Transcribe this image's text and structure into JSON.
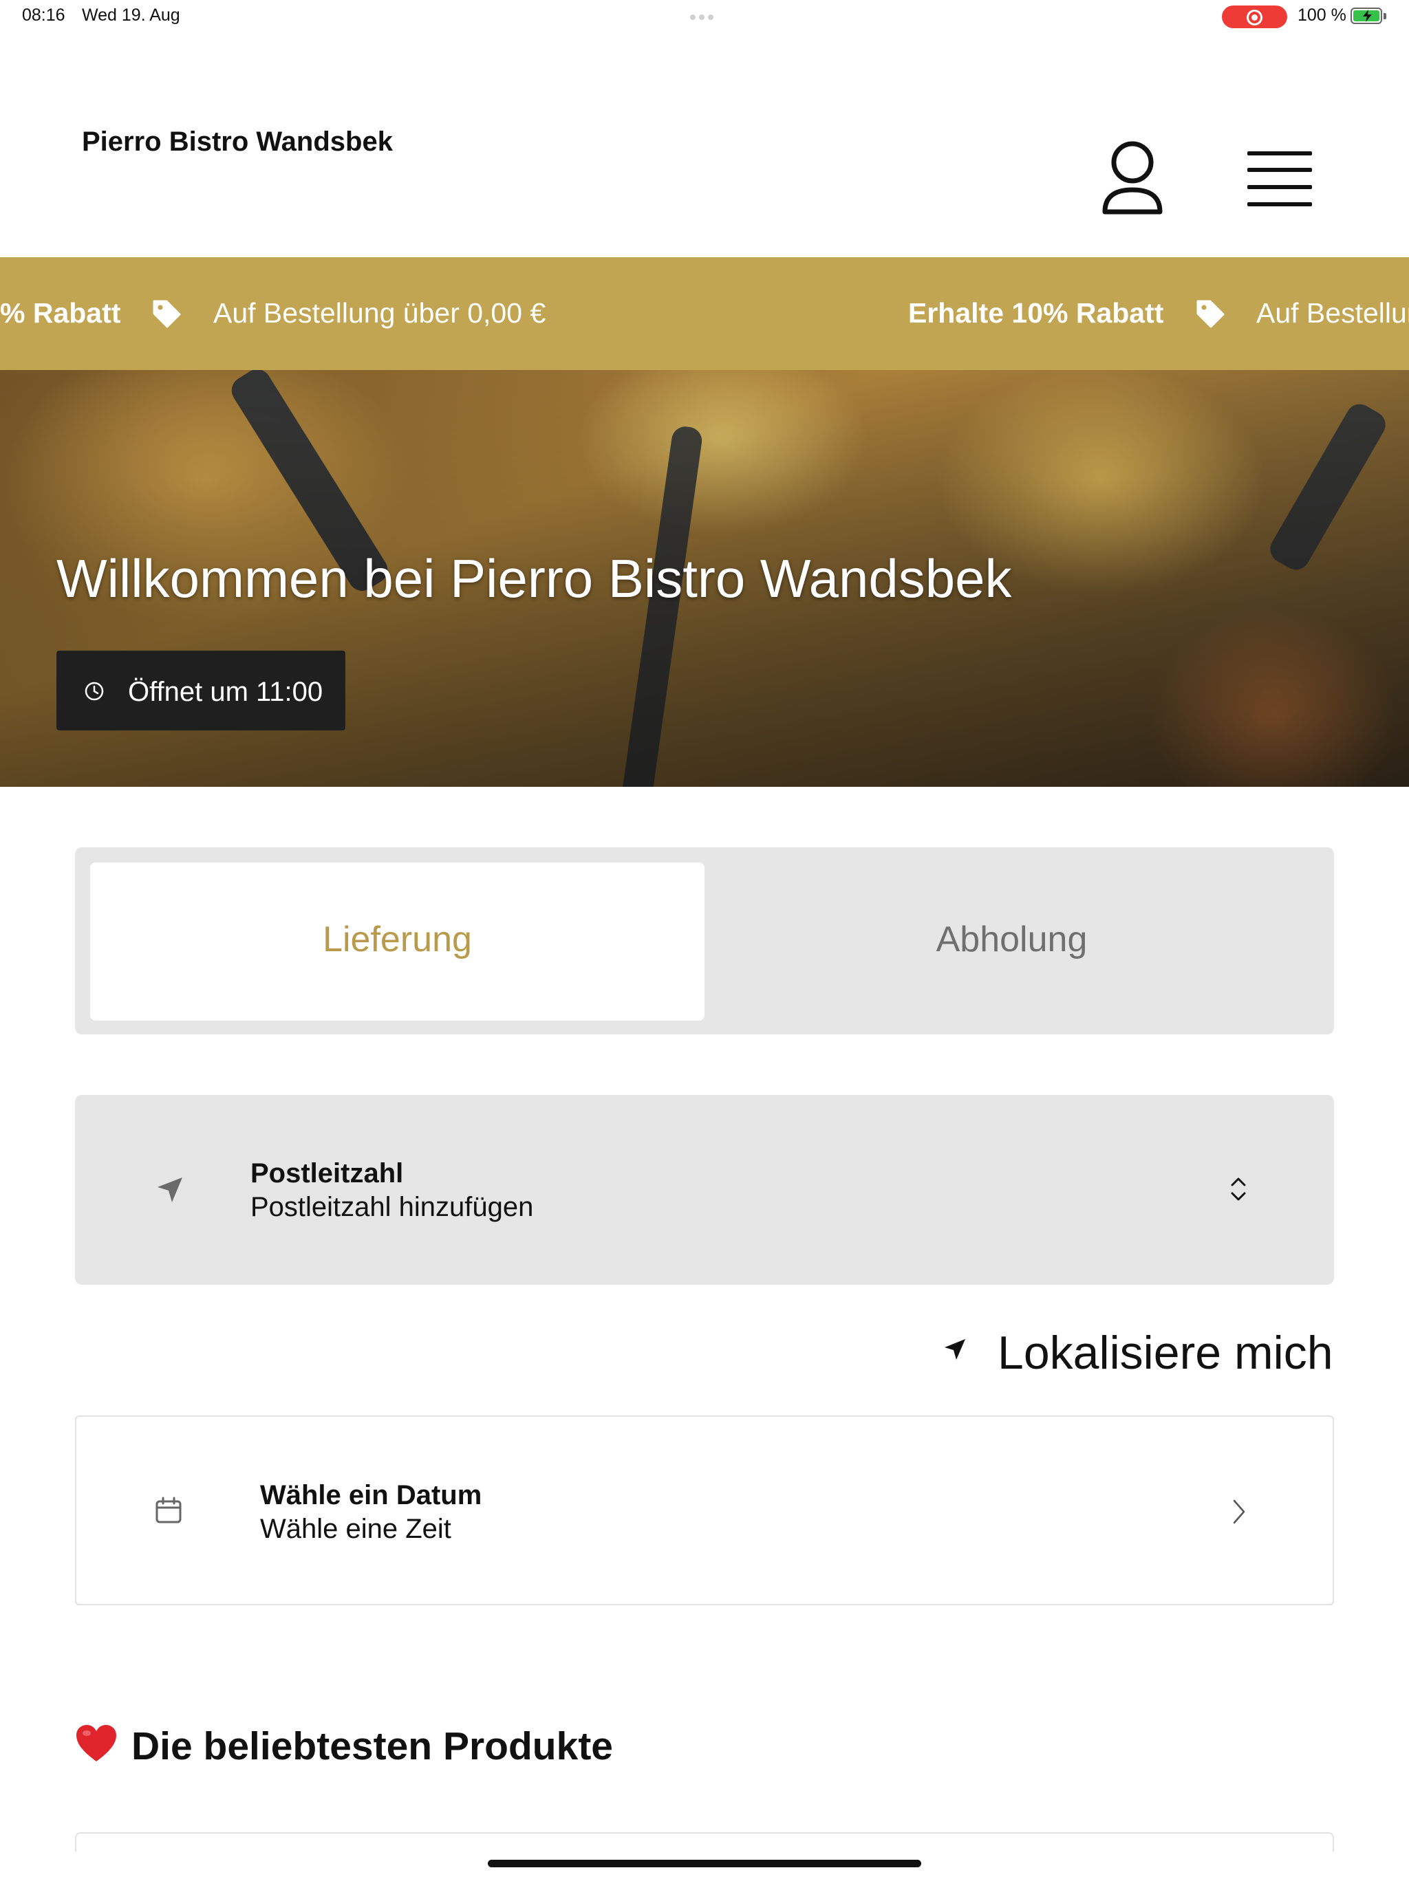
{
  "status_bar": {
    "time": "08:16",
    "date": "Wed 19. Aug",
    "battery": "100 %"
  },
  "header": {
    "brand": "Pierro Bistro Wandsbek",
    "profile_icon": "person-icon",
    "menu_icon": "hamburger-menu-icon"
  },
  "promo": {
    "color": "#c2a552",
    "items": [
      {
        "text": "% Rabatt",
        "bold": true
      },
      {
        "text": "Auf Bestellung über 0,00 €",
        "bold": false
      },
      {
        "text": "Erhalte 10% Rabatt",
        "bold": true
      },
      {
        "text": "Auf Bestellur",
        "bold": false
      }
    ],
    "icon": "tag-icon"
  },
  "hero": {
    "title": "Willkommen bei Pierro Bistro Wandsbek",
    "open_label": "Öffnet um 11:00",
    "clock_icon": "clock-icon"
  },
  "order_mode": {
    "options": [
      "Lieferung",
      "Abholung"
    ],
    "selected": "Lieferung",
    "accent": "#b89a4a"
  },
  "postal": {
    "title": "Postleitzahl",
    "placeholder": "Postleitzahl hinzufügen",
    "icon": "navigation-arrow-icon",
    "chevron_icon": "chevron-up-down-icon"
  },
  "locate": {
    "label": "Lokalisiere mich",
    "icon": "location-arrow-icon"
  },
  "datetime": {
    "title": "Wähle ein Datum",
    "subtitle": "Wähle eine Zeit",
    "icon": "calendar-icon",
    "chevron_icon": "chevron-right-icon"
  },
  "popular": {
    "title": "Die beliebtesten Produkte",
    "icon": "heart-icon"
  }
}
